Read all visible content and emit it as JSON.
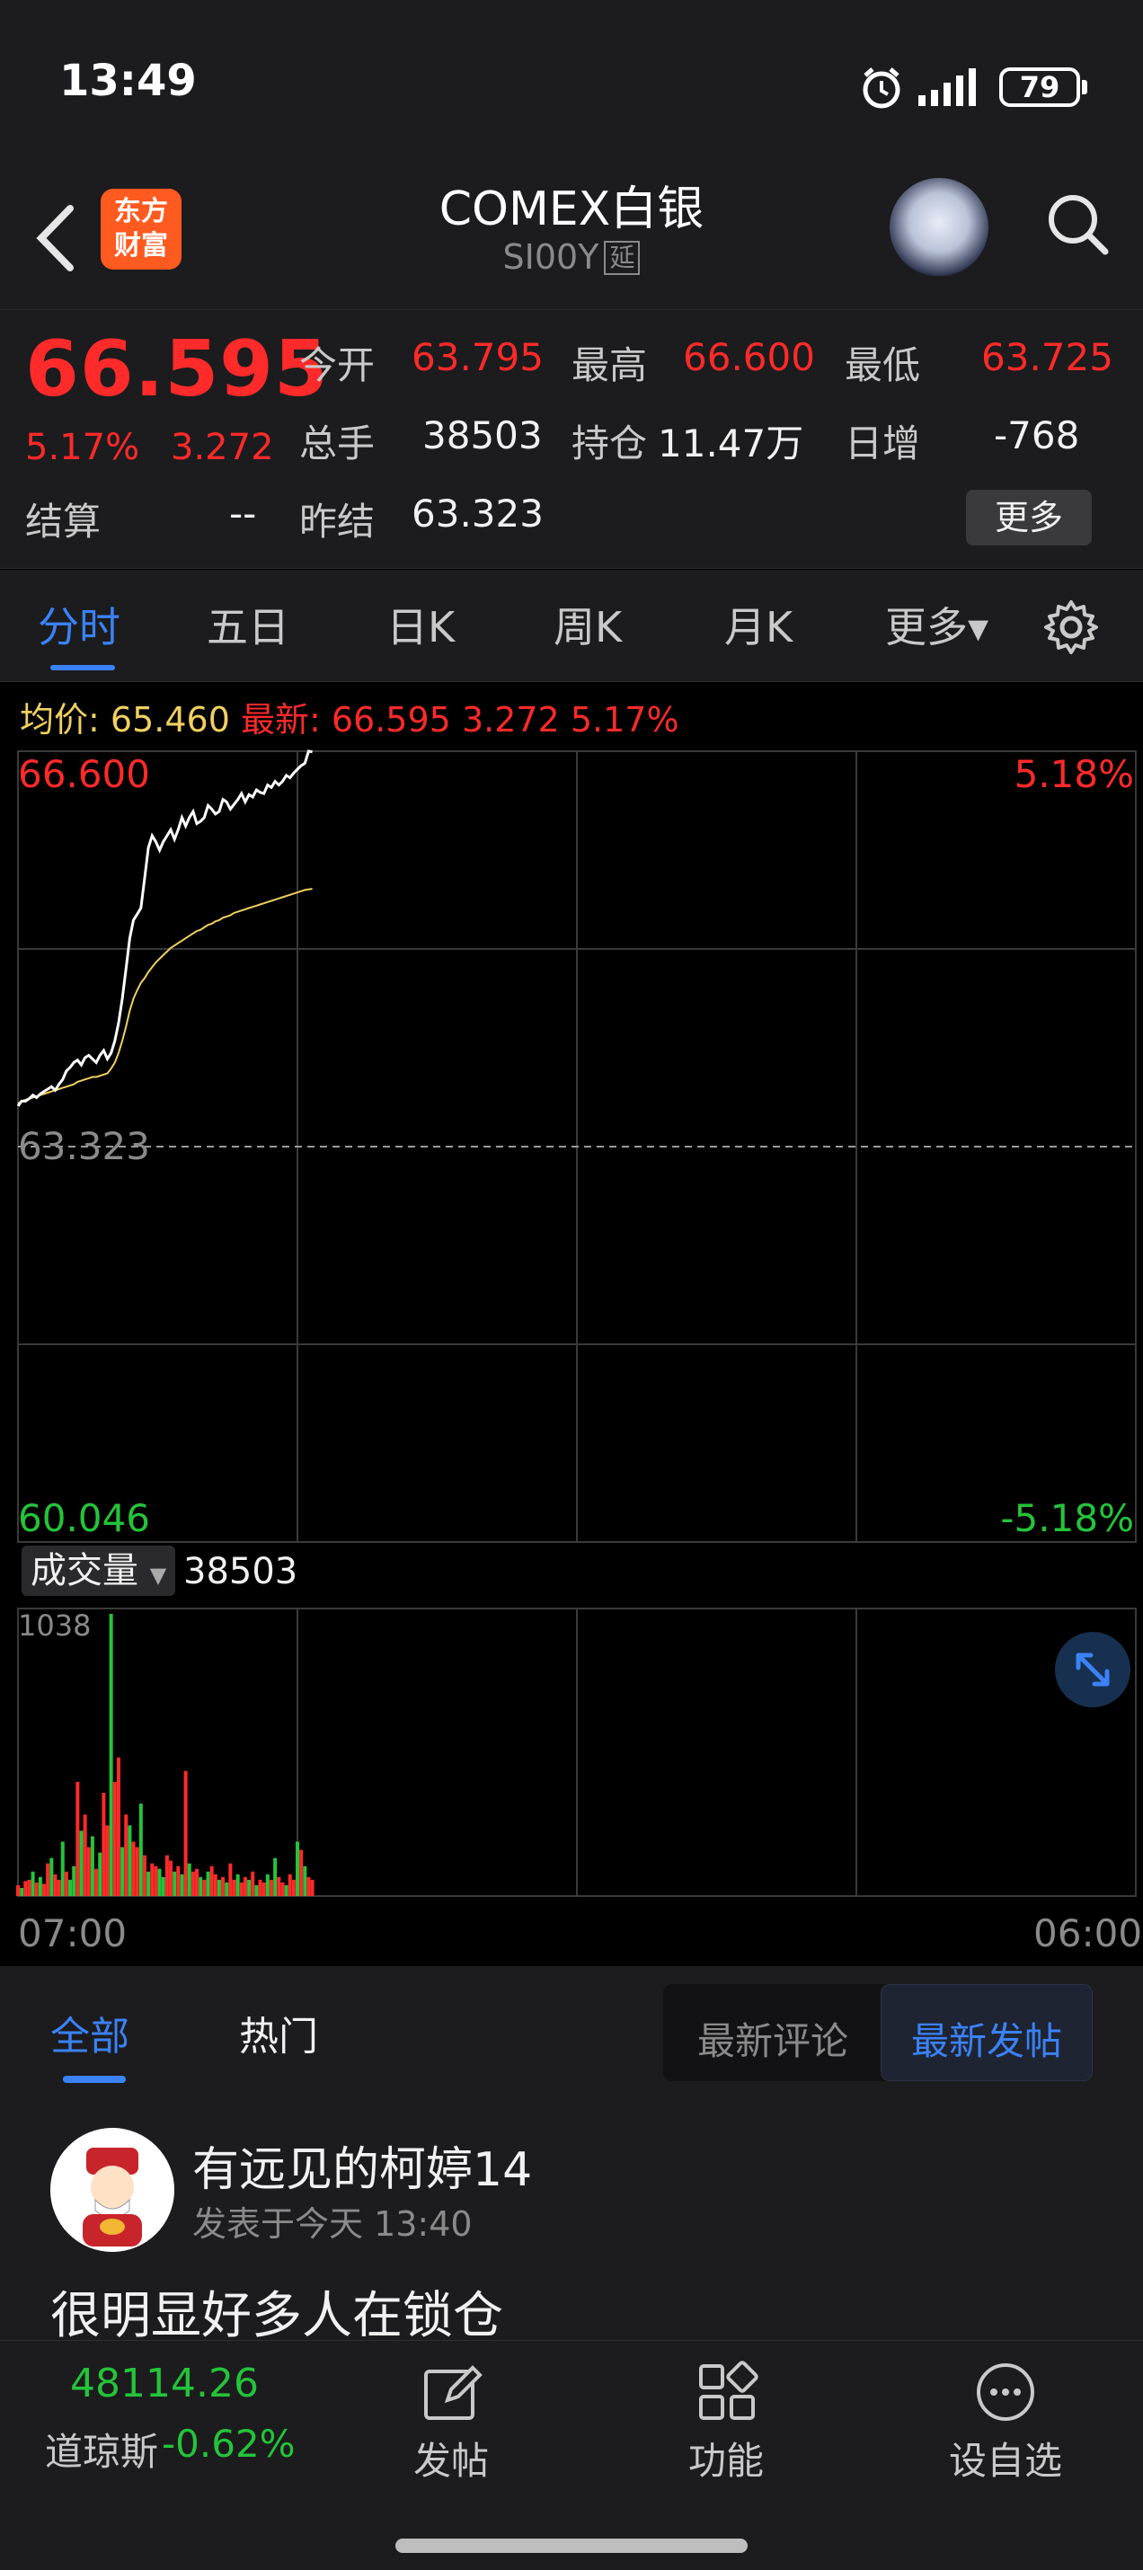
{
  "status_bar": {
    "time": "13:49",
    "battery": "79"
  },
  "header": {
    "brand": "东方\n财富",
    "title": "COMEX白银",
    "code": "SI00Y",
    "delay_tag": "延"
  },
  "quote": {
    "price": "66.595",
    "change_pct": "5.17%",
    "change": "3.272",
    "open_label": "今开",
    "open": "63.795",
    "high_label": "最高",
    "high": "66.600",
    "low_label": "最低",
    "low": "63.725",
    "volume_label": "总手",
    "volume": "38503",
    "oi_label": "持仓",
    "oi": "11.47万",
    "daily_inc_label": "日增",
    "daily_inc": "-768",
    "settle_label": "结算",
    "settle": "--",
    "prev_settle_label": "昨结",
    "prev_settle": "63.323",
    "more_button": "更多"
  },
  "tabs": [
    "分时",
    "五日",
    "日K",
    "周K",
    "月K",
    "更多▾"
  ],
  "chart_info": {
    "avg_label": "均价:",
    "avg": "65.460",
    "latest_label": "最新:",
    "latest": "66.595",
    "change": "3.272",
    "pct": "5.17%"
  },
  "chart_data": {
    "type": "line",
    "price_axis": {
      "max": "66.600",
      "mid": "63.323",
      "min": "60.046",
      "max_pct": "5.18%",
      "min_pct": "-5.18%",
      "ylim": [
        60.046,
        66.6
      ]
    },
    "time_axis": {
      "start": "07:00",
      "end": "06:00"
    },
    "price_series": [
      63.66,
      63.7,
      63.7,
      63.72,
      63.75,
      63.73,
      63.76,
      63.78,
      63.8,
      63.82,
      63.79,
      63.84,
      63.88,
      63.95,
      63.98,
      64.02,
      64.04,
      64.0,
      64.06,
      64.08,
      64.05,
      64.02,
      64.08,
      64.12,
      64.05,
      64.1,
      64.2,
      64.35,
      64.55,
      64.8,
      65.05,
      65.2,
      65.25,
      65.3,
      65.55,
      65.8,
      65.9,
      65.85,
      65.78,
      65.85,
      65.9,
      65.95,
      65.87,
      65.95,
      66.05,
      65.98,
      66.05,
      66.1,
      66.0,
      66.02,
      66.05,
      66.15,
      66.12,
      66.08,
      66.1,
      66.2,
      66.18,
      66.12,
      66.16,
      66.2,
      66.25,
      66.18,
      66.24,
      66.22,
      66.28,
      66.26,
      66.25,
      66.32,
      66.3,
      66.35,
      66.32,
      66.35,
      66.4,
      66.38,
      66.42,
      66.45,
      66.48,
      66.5,
      66.6,
      66.595
    ],
    "avg_series": [
      63.68,
      63.7,
      63.71,
      63.72,
      63.73,
      63.74,
      63.75,
      63.76,
      63.77,
      63.78,
      63.79,
      63.8,
      63.81,
      63.82,
      63.83,
      63.84,
      63.86,
      63.87,
      63.88,
      63.89,
      63.9,
      63.9,
      63.91,
      63.92,
      63.93,
      63.97,
      64.02,
      64.1,
      64.2,
      64.32,
      64.45,
      64.55,
      64.62,
      64.68,
      64.72,
      64.77,
      64.81,
      64.85,
      64.88,
      64.91,
      64.94,
      64.97,
      64.99,
      65.01,
      65.03,
      65.05,
      65.07,
      65.09,
      65.11,
      65.12,
      65.14,
      65.16,
      65.17,
      65.19,
      65.2,
      65.22,
      65.23,
      65.24,
      65.26,
      65.27,
      65.28,
      65.29,
      65.3,
      65.31,
      65.32,
      65.33,
      65.34,
      65.35,
      65.36,
      65.37,
      65.38,
      65.39,
      65.4,
      65.41,
      65.42,
      65.43,
      65.44,
      65.45,
      65.455,
      65.46
    ],
    "volume_label": "成交量",
    "volume_total": "38503",
    "volume_max_label": "1038",
    "volume_series": [
      40,
      30,
      55,
      60,
      90,
      50,
      70,
      45,
      120,
      140,
      80,
      60,
      200,
      90,
      60,
      110,
      420,
      240,
      300,
      180,
      220,
      100,
      160,
      380,
      260,
      1038,
      420,
      510,
      180,
      300,
      260,
      200,
      180,
      340,
      150,
      90,
      120,
      110,
      100,
      70,
      150,
      130,
      90,
      110,
      80,
      460,
      120,
      90,
      100,
      70,
      60,
      90,
      110,
      80,
      60,
      70,
      50,
      120,
      60,
      80,
      50,
      70,
      60,
      90,
      40,
      60,
      50,
      80,
      60,
      140,
      70,
      50,
      40,
      80,
      60,
      200,
      170,
      110,
      70,
      60
    ],
    "volume_colors": "rgrrgrgrrgrrgrggrgrrgrgrrgrrgrgrrgrgrrggrrgrgrgrrgrgrrgrgrrgrrgrgrrgrgrrgrrgrgr"
  },
  "community": {
    "tabs": [
      "全部",
      "热门"
    ],
    "sort_options": [
      "最新评论",
      "最新发帖"
    ],
    "author": "有远见的柯婷14",
    "post_time": "发表于今天 13:40",
    "post_text": "很明显好多人在锁仓"
  },
  "bottom_bar": {
    "index_value": "48114.26",
    "index_name": "道琼斯",
    "index_change": "-0.62%",
    "items": [
      "发帖",
      "功能",
      "设自选"
    ]
  },
  "colors": {
    "up": "#ff2a2a",
    "down": "#24c43a",
    "accent": "#3b82f6",
    "avg_line": "#f0d060"
  }
}
